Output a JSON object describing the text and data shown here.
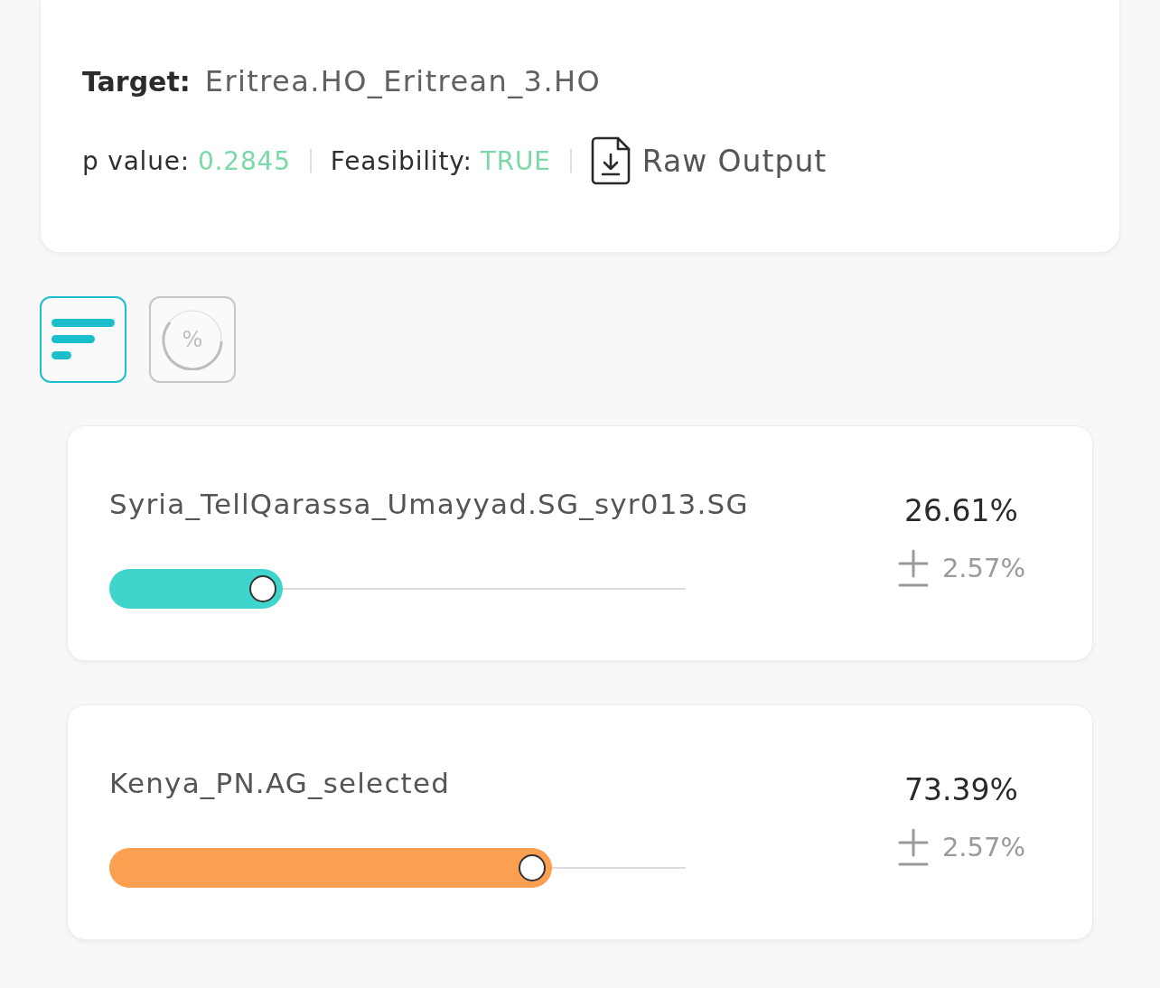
{
  "summary": {
    "target_label": "Target:",
    "target": "Eritrea.HO_Eritrean_3.HO",
    "p_value_label": "p value:",
    "p_value": "0.2845",
    "feasibility_label": "Feasibility:",
    "feasibility": "TRUE",
    "raw_output": "Raw Output"
  },
  "view_toggle": [
    {
      "kind": "bars",
      "selected": true
    },
    {
      "kind": "percent",
      "label": "%",
      "selected": false
    }
  ],
  "sources": [
    {
      "name": "Syria_TellQarassa_Umayyad.SG_syr013.SG",
      "level": 0.2661,
      "color": "#3fd4cc",
      "percent": "26.61%",
      "error": "2.57%"
    },
    {
      "name": "Kenya_PN.AG_selected",
      "level": 0.7339,
      "color": "#fb9f50",
      "percent": "73.39%",
      "error": "2.57%"
    }
  ]
}
